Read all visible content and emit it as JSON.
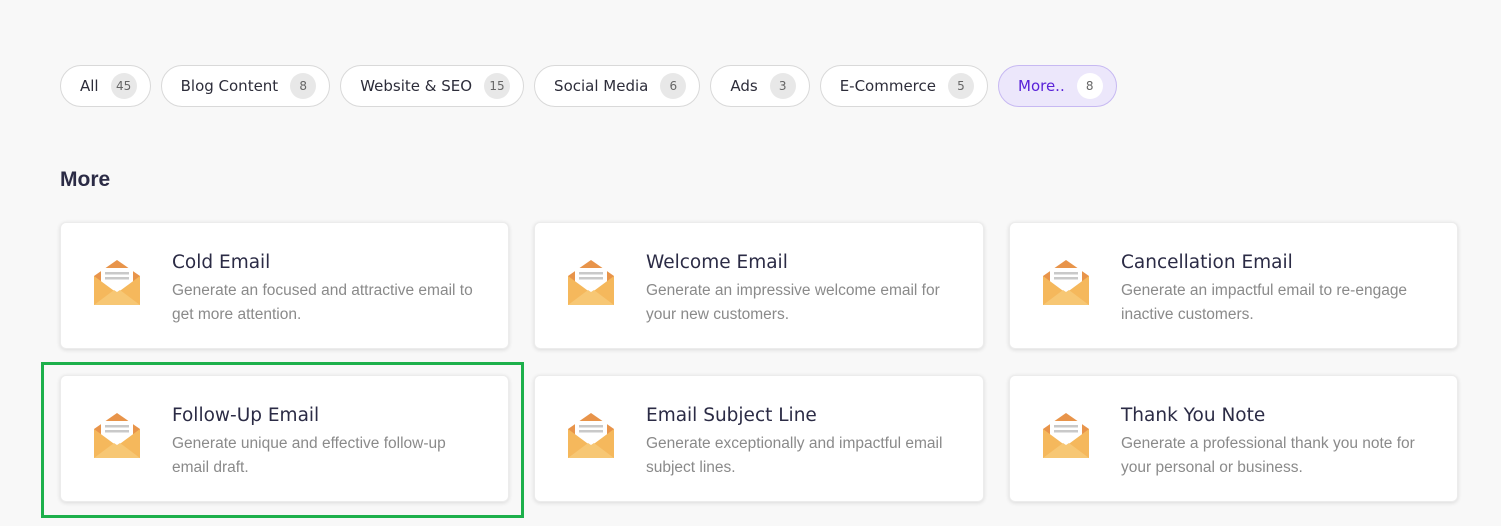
{
  "filters": [
    {
      "label": "All",
      "count": "45",
      "active": false
    },
    {
      "label": "Blog Content",
      "count": "8",
      "active": false
    },
    {
      "label": "Website & SEO",
      "count": "15",
      "active": false
    },
    {
      "label": "Social Media",
      "count": "6",
      "active": false
    },
    {
      "label": "Ads",
      "count": "3",
      "active": false
    },
    {
      "label": "E-Commerce",
      "count": "5",
      "active": false
    },
    {
      "label": "More..",
      "count": "8",
      "active": true
    }
  ],
  "section": {
    "title": "More"
  },
  "cards": [
    {
      "title": "Cold Email",
      "description": "Generate an focused and attractive email to get more attention.",
      "icon": "envelope-icon"
    },
    {
      "title": "Welcome Email",
      "description": "Generate an impressive welcome email for your new customers.",
      "icon": "envelope-icon"
    },
    {
      "title": "Cancellation Email",
      "description": "Generate an impactful email to re-engage inactive customers.",
      "icon": "envelope-icon"
    },
    {
      "title": "Follow-Up Email",
      "description": "Generate unique and effective follow-up email draft.",
      "icon": "envelope-icon"
    },
    {
      "title": "Email Subject Line",
      "description": "Generate exceptionally and impactful email subject lines.",
      "icon": "envelope-icon"
    },
    {
      "title": "Thank You Note",
      "description": "Generate a professional thank you note for your personal or business.",
      "icon": "envelope-icon"
    }
  ],
  "colors": {
    "accent": "#5a22d8",
    "active_pill_bg": "#ece7fb",
    "envelope_back": "#e8944a",
    "envelope_front": "#f5b85c",
    "highlight": "#1db04b"
  }
}
